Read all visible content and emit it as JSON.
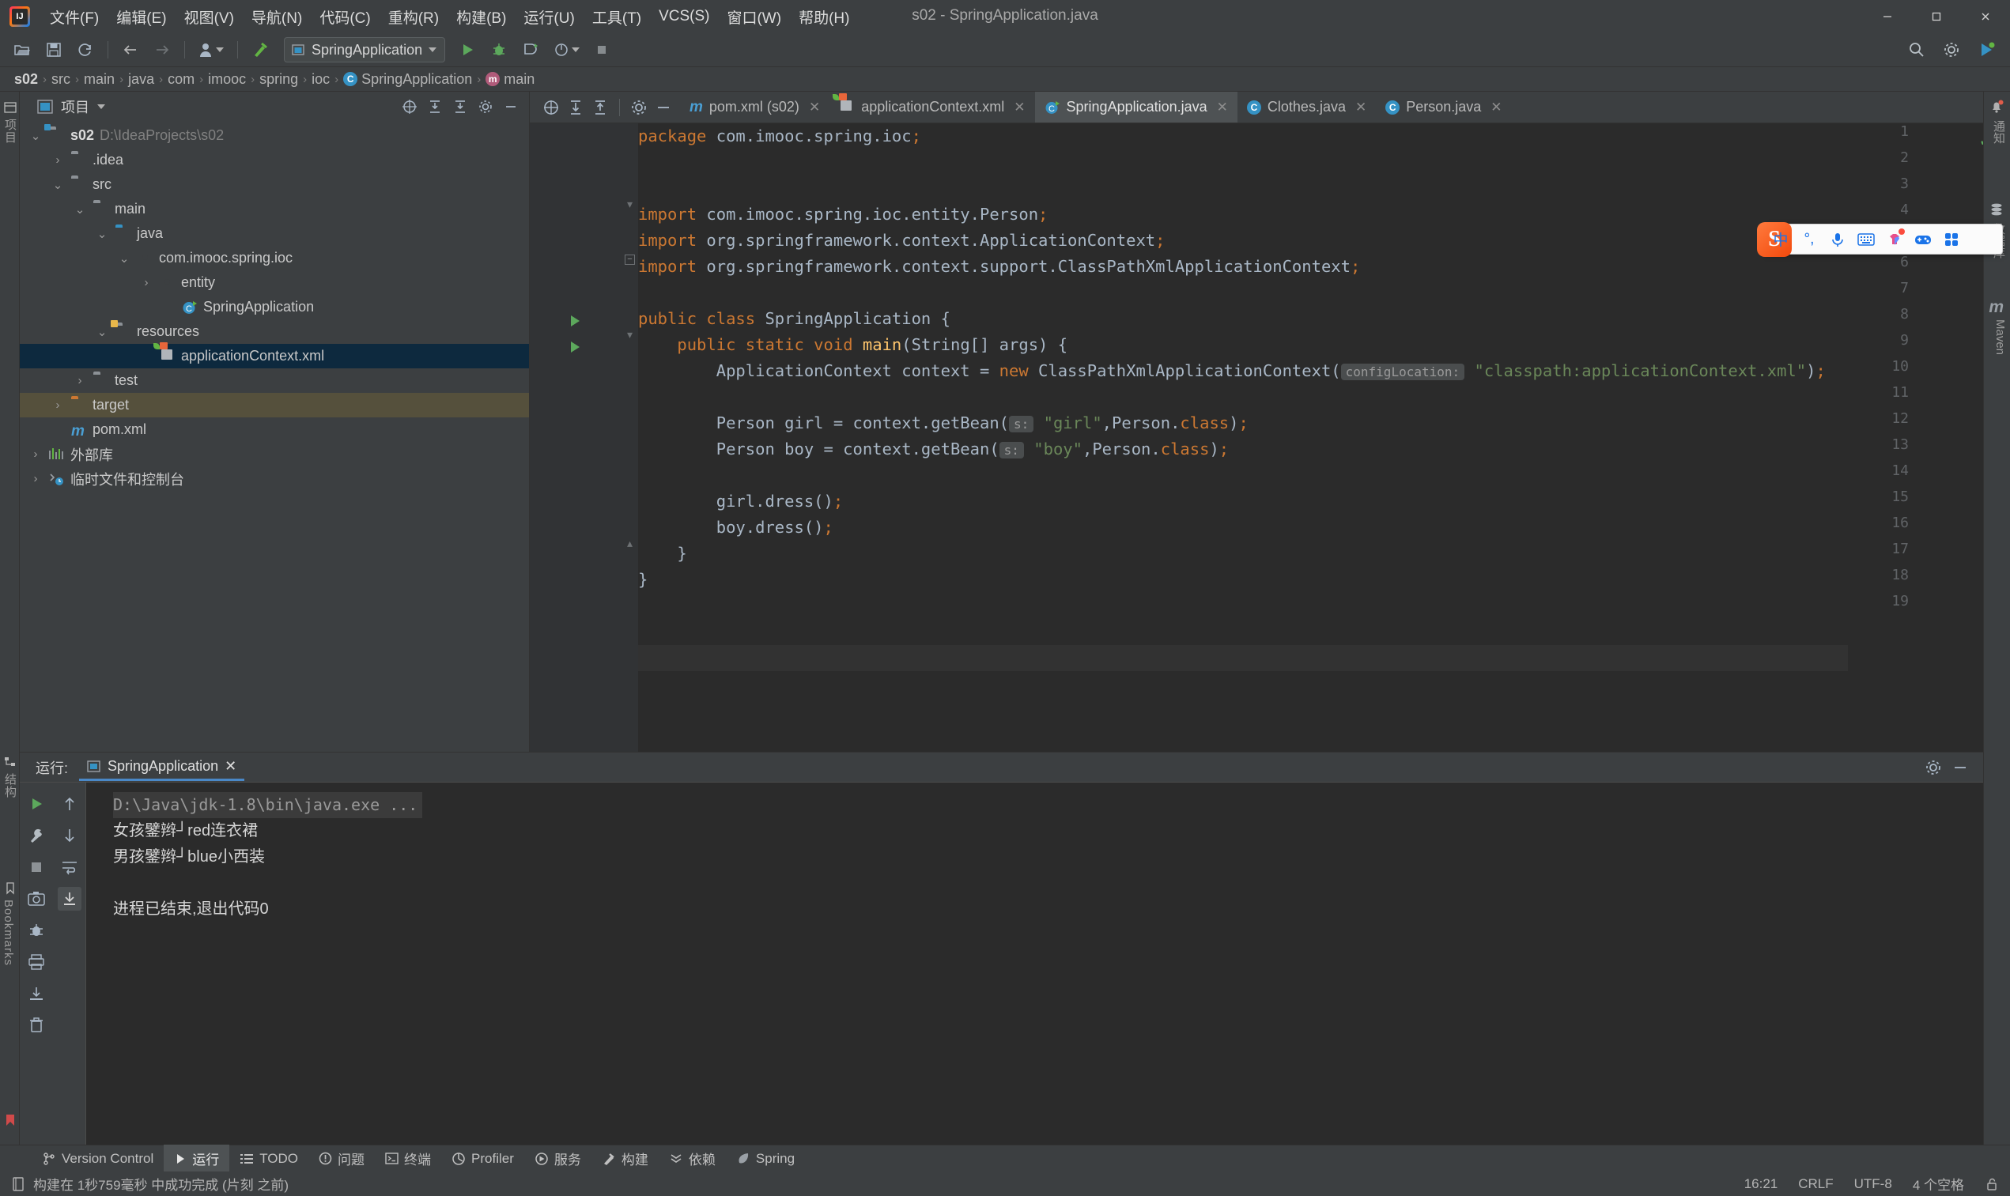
{
  "window": {
    "title": "s02 - SpringApplication.java",
    "minimize": "—",
    "maximize": "☐",
    "close": "✕"
  },
  "menu": {
    "items": [
      {
        "label": "文件(F)",
        "name": "menu-file"
      },
      {
        "label": "编辑(E)",
        "name": "menu-edit"
      },
      {
        "label": "视图(V)",
        "name": "menu-view"
      },
      {
        "label": "导航(N)",
        "name": "menu-navigate"
      },
      {
        "label": "代码(C)",
        "name": "menu-code"
      },
      {
        "label": "重构(R)",
        "name": "menu-refactor"
      },
      {
        "label": "构建(B)",
        "name": "menu-build"
      },
      {
        "label": "运行(U)",
        "name": "menu-run"
      },
      {
        "label": "工具(T)",
        "name": "menu-tools"
      },
      {
        "label": "VCS(S)",
        "name": "menu-vcs"
      },
      {
        "label": "窗口(W)",
        "name": "menu-window"
      },
      {
        "label": "帮助(H)",
        "name": "menu-help"
      }
    ]
  },
  "toolbar": {
    "run_config": "SpringApplication",
    "icons": [
      "open-folder-icon",
      "save-icon",
      "sync-icon",
      "back-arrow-icon",
      "forward-arrow-icon",
      "profile-dropdown-icon",
      "build-hammer-icon"
    ],
    "right_icons": [
      "search-icon",
      "settings-gear-icon",
      "updates-icon"
    ]
  },
  "breadcrumb": {
    "items": [
      "s02",
      "src",
      "main",
      "java",
      "com",
      "imooc",
      "spring",
      "ioc",
      "SpringApplication",
      "main"
    ],
    "separator": "›"
  },
  "project_panel": {
    "title": "项目",
    "header_icons": [
      "collapse-all-icon",
      "expand-all-icon",
      "sort-icon",
      "settings-gear-icon",
      "hide-icon"
    ],
    "tree": [
      {
        "label": "s02",
        "sub": "D:\\IdeaProjects\\s02",
        "depth": 0,
        "arrow": "⌄",
        "icon": "module-folder",
        "bold": true
      },
      {
        "label": ".idea",
        "depth": 1,
        "arrow": "›",
        "icon": "folder"
      },
      {
        "label": "src",
        "depth": 1,
        "arrow": "⌄",
        "icon": "folder"
      },
      {
        "label": "main",
        "depth": 2,
        "arrow": "⌄",
        "icon": "folder"
      },
      {
        "label": "java",
        "depth": 3,
        "arrow": "⌄",
        "icon": "source-folder"
      },
      {
        "label": "com.imooc.spring.ioc",
        "depth": 4,
        "arrow": "⌄",
        "icon": "package"
      },
      {
        "label": "entity",
        "depth": 5,
        "arrow": "›",
        "icon": "package"
      },
      {
        "label": "SpringApplication",
        "depth": 5,
        "arrow": "",
        "icon": "runnable-class"
      },
      {
        "label": "resources",
        "depth": 3,
        "arrow": "⌄",
        "icon": "resource-folder"
      },
      {
        "label": "applicationContext.xml",
        "depth": 4,
        "arrow": "",
        "icon": "spring-xml",
        "selected": true
      },
      {
        "label": "test",
        "depth": 2,
        "arrow": "›",
        "icon": "folder"
      },
      {
        "label": "target",
        "depth": 1,
        "arrow": "›",
        "icon": "excluded-folder",
        "excluded": true
      },
      {
        "label": "pom.xml",
        "depth": 1,
        "arrow": "",
        "icon": "maven-file"
      },
      {
        "label": "外部库",
        "depth": 0,
        "arrow": "›",
        "icon": "libraries"
      },
      {
        "label": "临时文件和控制台",
        "depth": 0,
        "arrow": "›",
        "icon": "scratches"
      }
    ]
  },
  "left_strip": {
    "tools": [
      {
        "label": "项目"
      },
      {
        "label": "结构"
      },
      {
        "label": "Bookmarks"
      }
    ]
  },
  "right_strip": {
    "tools": [
      {
        "label": "通知"
      },
      {
        "label": "数据库"
      },
      {
        "label": "Maven"
      }
    ]
  },
  "editor_tabs": [
    {
      "label": "pom.xml (s02)",
      "icon": "maven-file-icon",
      "active": false
    },
    {
      "label": "applicationContext.xml",
      "icon": "spring-xml-icon",
      "active": false
    },
    {
      "label": "SpringApplication.java",
      "icon": "runnable-class-icon",
      "active": true
    },
    {
      "label": "Clothes.java",
      "icon": "class-icon",
      "active": false
    },
    {
      "label": "Person.java",
      "icon": "class-icon",
      "active": false
    }
  ],
  "editor": {
    "line_numbers": [
      "1",
      "2",
      "3",
      "4",
      "5",
      "6",
      "7",
      "8",
      "9",
      "10",
      "11",
      "12",
      "13",
      "14",
      "15",
      "16",
      "17",
      "18",
      "19"
    ],
    "current_line": 16,
    "inspection_status": "✓",
    "lines": [
      {
        "n": 1,
        "text": "package com.imooc.spring.ioc;"
      },
      {
        "n": 2,
        "text": ""
      },
      {
        "n": 3,
        "text": ""
      },
      {
        "n": 4,
        "text": "import com.imooc.spring.ioc.entity.Person;"
      },
      {
        "n": 5,
        "text": "import org.springframework.context.ApplicationContext;"
      },
      {
        "n": 6,
        "text": "import org.springframework.context.support.ClassPathXmlApplicationContext;"
      },
      {
        "n": 7,
        "text": ""
      },
      {
        "n": 8,
        "text": "public class SpringApplication {"
      },
      {
        "n": 9,
        "text": "    public static void main(String[] args) {"
      },
      {
        "n": 10,
        "text": "        ApplicationContext context = new ClassPathXmlApplicationContext( configLocation: \"classpath:applicationContext.xml\");"
      },
      {
        "n": 11,
        "text": ""
      },
      {
        "n": 12,
        "text": "        Person girl = context.getBean( s: \"girl\",Person.class);"
      },
      {
        "n": 13,
        "text": "        Person boy = context.getBean( s: \"boy\",Person.class);"
      },
      {
        "n": 14,
        "text": ""
      },
      {
        "n": 15,
        "text": "        girl.dress();"
      },
      {
        "n": 16,
        "text": "        boy.dress();"
      },
      {
        "n": 17,
        "text": "    }"
      },
      {
        "n": 18,
        "text": "}"
      },
      {
        "n": 19,
        "text": ""
      }
    ],
    "hints": {
      "config_location": "configLocation:",
      "s_param": "s:"
    },
    "strings": {
      "classpath": "\"classpath:applicationContext.xml\"",
      "girl": "\"girl\"",
      "boy": "\"boy\""
    }
  },
  "ime": {
    "logo": "S",
    "items": [
      "chinese-mode-icon",
      "punctuation-icon",
      "microphone-icon",
      "keyboard-icon",
      "skin-icon",
      "game-icon",
      "apps-grid-icon"
    ],
    "chinese_label": "中",
    "punct_label": "°,"
  },
  "run_panel": {
    "label": "运行:",
    "tab": "SpringApplication",
    "tab_close": "✕",
    "sidebar_icons": [
      "run-icon",
      "wrench-icon",
      "stop-icon",
      "camera-icon",
      "bug-icon",
      "print-icon",
      "export-icon",
      "trash-icon"
    ],
    "sidebar2_icons": [
      "scroll-up-icon",
      "scroll-down-icon",
      "soft-wrap-icon",
      "scroll-to-end-icon"
    ],
    "header_right_icons": [
      "settings-gear-icon",
      "hide-icon"
    ],
    "console_lines": [
      {
        "text": "D:\\Java\\jdk-1.8\\bin\\java.exe ...",
        "type": "cmd"
      },
      {
        "text": "女孩鐾辫┘red连衣裙",
        "type": "out"
      },
      {
        "text": "男孩鐾辫┘blue小西装",
        "type": "out"
      },
      {
        "text": "",
        "type": "out"
      },
      {
        "text": "进程已结束,退出代码0",
        "type": "out"
      }
    ]
  },
  "bottom_bar": {
    "items": [
      {
        "label": "Version Control",
        "icon": "branch-icon",
        "active": false
      },
      {
        "label": "运行",
        "icon": "run-icon",
        "active": true
      },
      {
        "label": "TODO",
        "icon": "list-icon",
        "active": false
      },
      {
        "label": "问题",
        "icon": "warning-icon",
        "active": false
      },
      {
        "label": "终端",
        "icon": "terminal-icon",
        "active": false
      },
      {
        "label": "Profiler",
        "icon": "profiler-icon",
        "active": false
      },
      {
        "label": "服务",
        "icon": "services-icon",
        "active": false
      },
      {
        "label": "构建",
        "icon": "build-hammer-icon",
        "active": false
      },
      {
        "label": "依赖",
        "icon": "dependencies-icon",
        "active": false
      },
      {
        "label": "Spring",
        "icon": "spring-leaf-icon",
        "active": false
      }
    ]
  },
  "status_bar": {
    "message": "构建在 1秒759毫秒 中成功完成 (片刻 之前)",
    "time": "16:21",
    "line_sep": "CRLF",
    "encoding": "UTF-8",
    "indent": "4 个空格",
    "lock_icon": "unlocked-icon"
  },
  "colors": {
    "bg": "#3c3f41",
    "editor_bg": "#2b2b2b",
    "keyword": "#cc7832",
    "string": "#6a8759",
    "method": "#ffc66d",
    "text": "#a9b7c6",
    "accent": "#4a88c7",
    "selection": "#0d293e",
    "excluded": "#55503c",
    "green": "#62b543"
  }
}
